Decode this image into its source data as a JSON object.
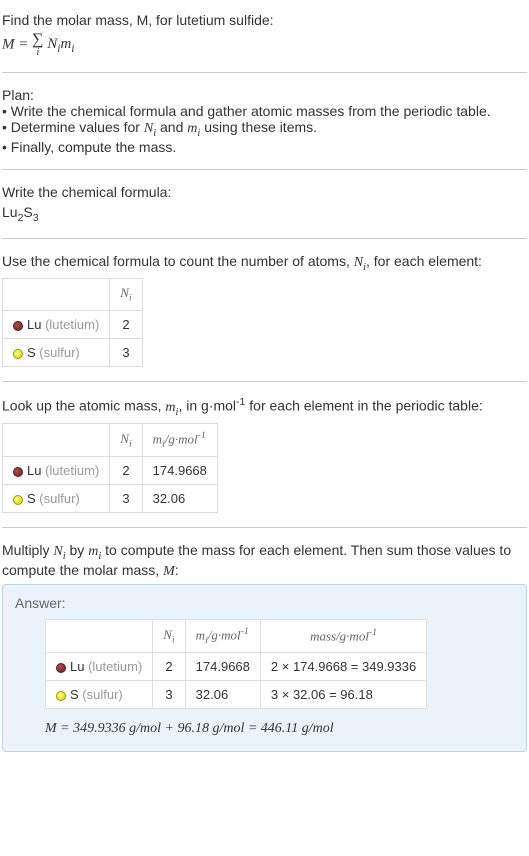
{
  "intro": {
    "line1": "Find the molar mass, M, for lutetium sulfide:",
    "formula_lhs": "M = ",
    "formula_rhs": " NᵢMᵢ"
  },
  "plan": {
    "heading": "Plan:",
    "b1": "• Write the chemical formula and gather atomic masses from the periodic table.",
    "b2_pre": "• Determine values for ",
    "b2_n": "Nᵢ",
    "b2_mid": " and ",
    "b2_m": "mᵢ",
    "b2_post": " using these items.",
    "b3": "• Finally, compute the mass."
  },
  "step_formula": {
    "heading": "Write the chemical formula:",
    "formula": "Lu₂S₃"
  },
  "step_count": {
    "heading_pre": "Use the chemical formula to count the number of atoms, ",
    "heading_n": "Nᵢ",
    "heading_post": ", for each element:",
    "col_n": "Nᵢ",
    "lu_sym": "Lu",
    "lu_name": "(lutetium)",
    "lu_n": "2",
    "s_sym": "S",
    "s_name": "(sulfur)",
    "s_n": "3"
  },
  "step_mass": {
    "heading_pre": "Look up the atomic mass, ",
    "heading_m": "mᵢ",
    "heading_mid": ", in g·mol",
    "heading_exp": "-1",
    "heading_post": " for each element in the periodic table:",
    "col_n": "Nᵢ",
    "col_m_pre": "mᵢ",
    "col_m_unit": "/g·mol",
    "col_m_exp": "-1",
    "lu_n": "2",
    "lu_m": "174.9668",
    "s_n": "3",
    "s_m": "32.06"
  },
  "step_multiply": {
    "heading_pre": "Multiply ",
    "heading_n": "Nᵢ",
    "heading_mid": " by ",
    "heading_m": "mᵢ",
    "heading_post": " to compute the mass for each element. Then sum those values to compute the molar mass, ",
    "heading_M": "M",
    "heading_colon": ":"
  },
  "answer": {
    "label": "Answer:",
    "col_n": "Nᵢ",
    "col_m_pre": "mᵢ",
    "col_m_unit": "/g·mol",
    "col_m_exp": "-1",
    "col_mass_pre": "mass/g·mol",
    "col_mass_exp": "-1",
    "lu_n": "2",
    "lu_m": "174.9668",
    "lu_mass": "2 × 174.9668 = 349.9336",
    "s_n": "3",
    "s_m": "32.06",
    "s_mass": "3 × 32.06 = 96.18",
    "final": "M = 349.9336 g/mol + 96.18 g/mol = 446.11 g/mol"
  }
}
